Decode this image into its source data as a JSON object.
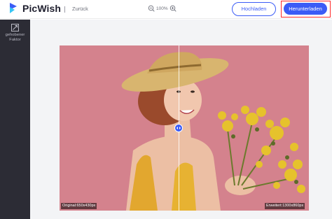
{
  "header": {
    "logo_text": "PicWish",
    "back_label": "Zurück",
    "zoom_level": "100%",
    "upload_label": "Hochladen",
    "download_label": "Herunterladen"
  },
  "sidebar": {
    "items": [
      {
        "label_line1": "gehobener",
        "label_line2": "Faktor",
        "icon": "expand-icon"
      }
    ]
  },
  "preview": {
    "original_label": "Original:650x430px",
    "enhanced_label": "Erweitert:1300x860px"
  },
  "colors": {
    "accent": "#3b5cf6",
    "highlight_border": "#ff2a2a",
    "sidebar_bg": "#2c2c35",
    "photo_bg": "#d4828d"
  }
}
